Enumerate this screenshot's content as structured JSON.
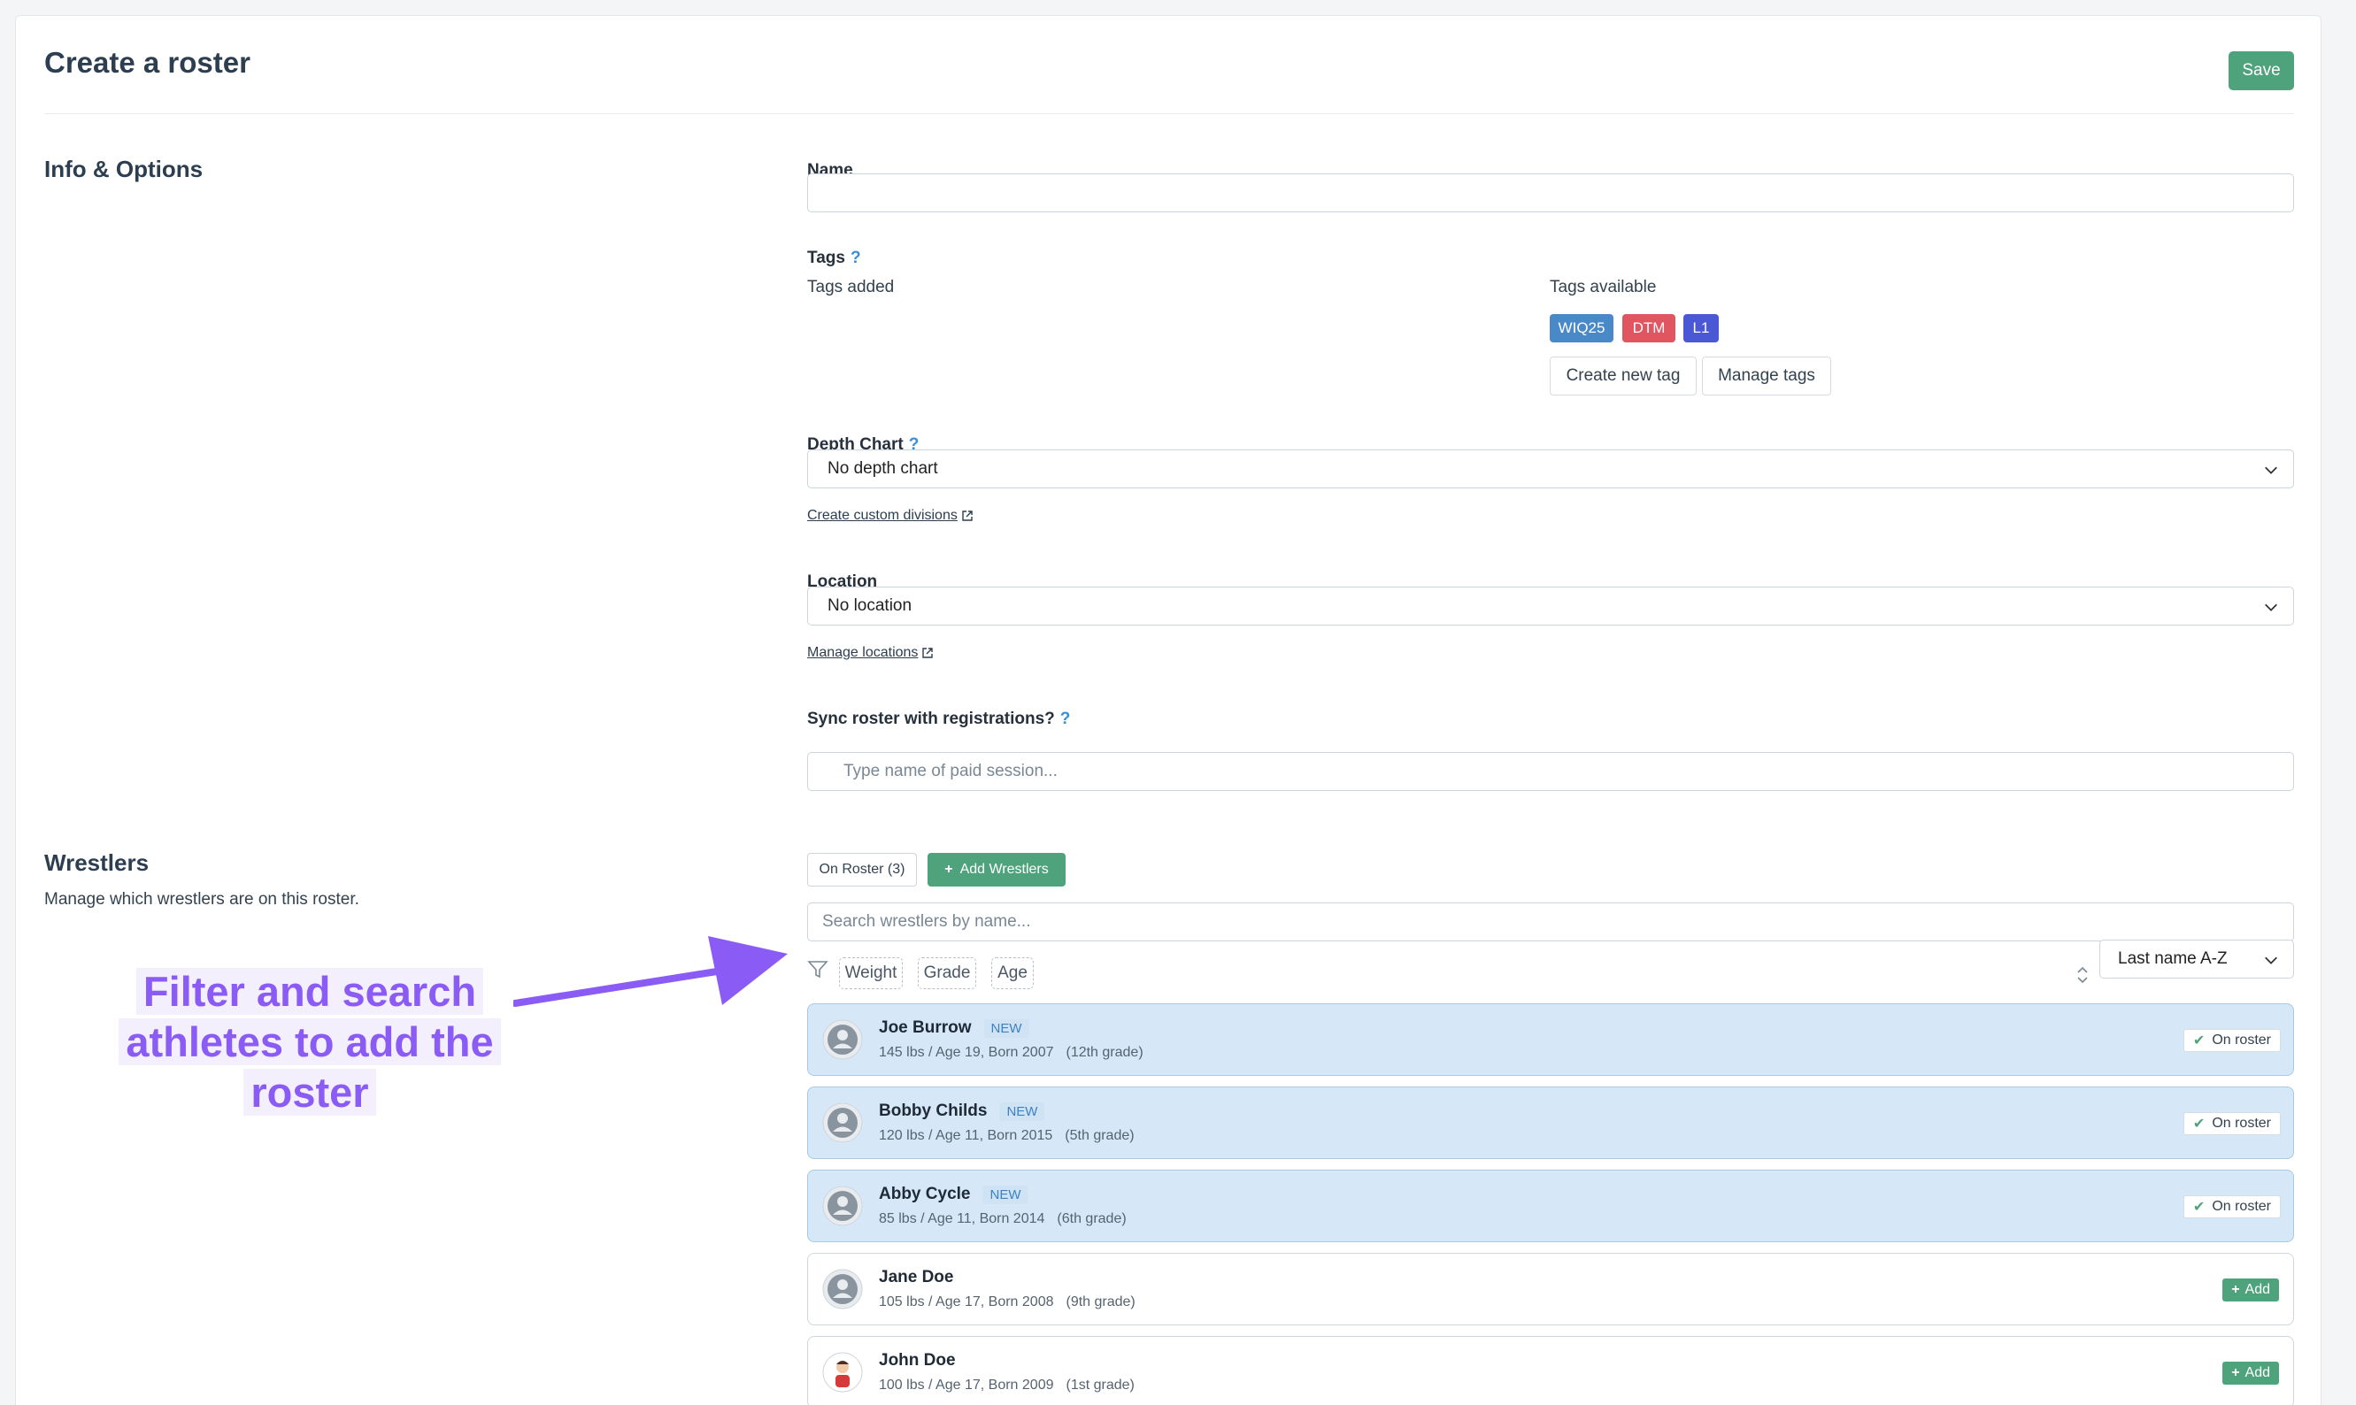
{
  "page": {
    "title": "Create a roster",
    "save_label": "Save"
  },
  "info_section": {
    "title": "Info & Options"
  },
  "name_field": {
    "label": "Name",
    "value": "",
    "placeholder": ""
  },
  "tags": {
    "label": "Tags",
    "help": "?",
    "added_label": "Tags added",
    "available_label": "Tags available",
    "available": [
      {
        "label": "WIQ25",
        "color": "#4a89c7"
      },
      {
        "label": "DTM",
        "color": "#e0555f"
      },
      {
        "label": "L1",
        "color": "#4a58d6"
      }
    ],
    "create_label": "Create new tag",
    "manage_label": "Manage tags"
  },
  "depth_chart": {
    "label": "Depth Chart",
    "help": "?",
    "value": "No depth chart",
    "link": "Create custom divisions"
  },
  "location": {
    "label": "Location",
    "value": "No location",
    "link": "Manage locations"
  },
  "sync": {
    "label": "Sync roster with registrations?",
    "help": "?",
    "placeholder": "Type name of paid session..."
  },
  "wrestlers_section": {
    "title": "Wrestlers",
    "description": "Manage which wrestlers are on this roster.",
    "on_roster_label": "On Roster (3)",
    "add_wrestlers_label": "Add Wrestlers",
    "search_placeholder": "Search wrestlers by name...",
    "filters": [
      "Weight",
      "Grade",
      "Age"
    ],
    "sort_value": "Last name A-Z"
  },
  "wrestlers": [
    {
      "name": "Joe Burrow",
      "badge": "NEW",
      "meta": "145 lbs / Age 19, Born 2007",
      "grade": "(12th grade)",
      "status": "On roster"
    },
    {
      "name": "Bobby Childs",
      "badge": "NEW",
      "meta": "120 lbs / Age 11, Born 2015",
      "grade": "(5th grade)",
      "status": "On roster"
    },
    {
      "name": "Abby Cycle",
      "badge": "NEW",
      "meta": "85 lbs / Age 11, Born 2014",
      "grade": "(6th grade)",
      "status": "On roster"
    },
    {
      "name": "Jane Doe",
      "badge": "",
      "meta": "105 lbs / Age 17, Born 2008",
      "grade": "(9th grade)",
      "action": "Add"
    },
    {
      "name": "John Doe",
      "badge": "",
      "meta": "100 lbs / Age 17, Born 2009",
      "grade": "(1st grade)",
      "action": "Add"
    }
  ],
  "annotation": {
    "line1": "Filter and search",
    "line2": "athletes to add the",
    "line3": "roster",
    "color": "#8a5cf5"
  },
  "colors": {
    "accent": "#4fa37c",
    "on_roster_bg": "#d6e8f7"
  }
}
